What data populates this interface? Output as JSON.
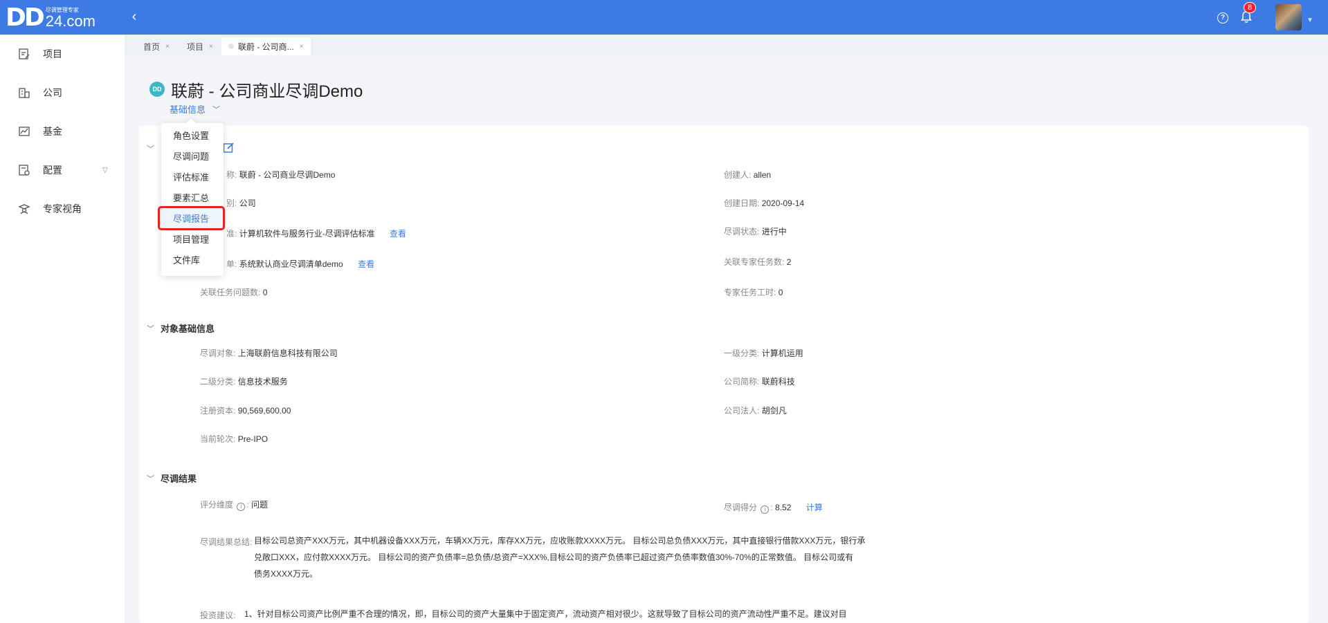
{
  "header": {
    "logo_main": "DD",
    "logo_tagline": "尽调管理专家",
    "logo_domain": "24.com",
    "notifications_count": "8",
    "help_symbol": "?",
    "collapse_symbol": "‹"
  },
  "sidebar": {
    "items": [
      {
        "label": "项目",
        "icon": "project-icon"
      },
      {
        "label": "公司",
        "icon": "company-icon"
      },
      {
        "label": "基金",
        "icon": "fund-icon"
      },
      {
        "label": "配置",
        "icon": "config-icon"
      },
      {
        "label": "专家视角",
        "icon": "expert-icon"
      }
    ]
  },
  "tabs": [
    {
      "label": "首页"
    },
    {
      "label": "项目"
    },
    {
      "label": "联蔚 - 公司商..."
    }
  ],
  "tab_close": "×",
  "page": {
    "icon_text": "DD",
    "title": "联蔚 - 公司商业尽调Demo",
    "sub_nav": "基础信息"
  },
  "dropdown": {
    "items": [
      "角色设置",
      "尽调问题",
      "评估标准",
      "要素汇总",
      "尽调报告",
      "项目管理",
      "文件库"
    ],
    "selected_index": 4
  },
  "project_info": {
    "name_key": "称:",
    "name_value": "联蔚 - 公司商业尽调Demo",
    "creator_key": "创建人:",
    "creator_value": "allen",
    "type_key": "别:",
    "type_value": "公司",
    "created_key": "创建日期:",
    "created_value": "2020-09-14",
    "standard_key": "准:",
    "standard_value": "计算机软件与服务行业-尽调评估标准",
    "view_link": "查看",
    "status_key": "尽调状态:",
    "status_value": "进行中",
    "list_key": "单:",
    "list_value": "系统默认商业尽调清单demo",
    "expert_tasks_key": "关联专家任务数:",
    "expert_tasks_value": "2",
    "task_questions_key": "关联任务问题数:",
    "task_questions_value": "0",
    "expert_hours_key": "专家任务工时:",
    "expert_hours_value": "0"
  },
  "object_info": {
    "title": "对象基础信息",
    "target_key": "尽调对象:",
    "target_value": "上海联蔚信息科技有限公司",
    "cat1_key": "一级分类:",
    "cat1_value": "计算机运用",
    "cat2_key": "二级分类:",
    "cat2_value": "信息技术服务",
    "short_key": "公司简称:",
    "short_value": "联蔚科技",
    "capital_key": "注册资本:",
    "capital_value": "90,569,600.00",
    "legal_key": "公司法人:",
    "legal_value": "胡剑凡",
    "round_key": "当前轮次:",
    "round_value": "Pre-IPO"
  },
  "result": {
    "title": "尽调结果",
    "dimension_key": "评分维度",
    "dimension_value": "问题",
    "score_key": "尽调得分",
    "score_value": "8.52",
    "calc_link": "计算",
    "summary_key": "尽调结果总结:",
    "summary_lines": [
      "目标公司总资产XXX万元，其中机器设备XXX万元，车辆XX万元，库存XX万元，应收账款XXXX万元。 目标公司总负债XXX万元，其中直接银行借款XXX万元，银行承",
      "兑敞口XXX，应付款XXXX万元。 目标公司的资产负债率=总负债/总资产=XXX%,目标公司的资产负债率已超过资产负债率数值30%-70%的正常数值。 目标公司或有",
      "债务XXXX万元。"
    ],
    "advice_key": "投资建议:",
    "advice_line": "1、针对目标公司资产比例严重不合理的情况，即，目标公司的资产大量集中于固定资产，流动资产相对很少。这就导致了目标公司的资产流动性严重不足。建议对目"
  },
  "colors": {
    "brand": "#3e7ae3",
    "highlight": "#e8231f"
  }
}
